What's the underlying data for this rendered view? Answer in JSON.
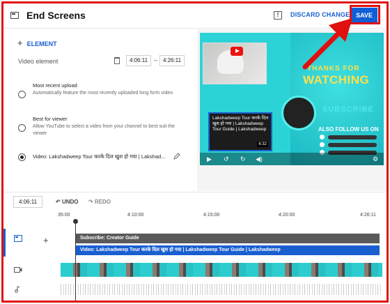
{
  "header": {
    "title": "End Screens",
    "discard_label": "DISCARD CHANGES",
    "save_label": "SAVE"
  },
  "editor": {
    "add_element_label": "ELEMENT",
    "video_element_label": "Video element",
    "start_time": "4:06:11",
    "end_time": "4:26:11",
    "options": [
      {
        "title": "Most recent upload",
        "description": "Automatically feature the most recently uploaded long form video",
        "selected": false
      },
      {
        "title": "Best for viewer",
        "description": "Allow YouTube to select a video from your channel to best suit the viewer",
        "selected": false
      },
      {
        "title": "Video: Lakshadweep Tour करके दिल खुश हो गया | Lakshad...",
        "description": "",
        "selected": true
      }
    ]
  },
  "preview": {
    "thanks_text": "THANKS FOR",
    "watching_text": "WATCHING",
    "subscribe_text": "SUBSCRIBE",
    "also_follow_text": "ALSO FOLLOW US ON",
    "card_title": "Lakshadweep Tour करके दिल खुश हो गया | Lakshadweep Tour Guide | Lakshadweep",
    "card_duration": "6:32"
  },
  "timeline": {
    "current_time": "4:06:11",
    "undo_label": "UNDO",
    "redo_label": "REDO",
    "ticks": [
      "35:00",
      "4:10:00",
      "4:15:00",
      "4:20:00",
      "4:26:11"
    ],
    "subscribe_bar": "Subscribe: Creator Guide",
    "video_bar": "Video: Lakshadweep Tour करके दिल खुश हो गया | Lakshadweep Tour Guide | Lakshadweep"
  },
  "colors": {
    "accent": "#0f5ed6",
    "highlight": "#e01010"
  }
}
